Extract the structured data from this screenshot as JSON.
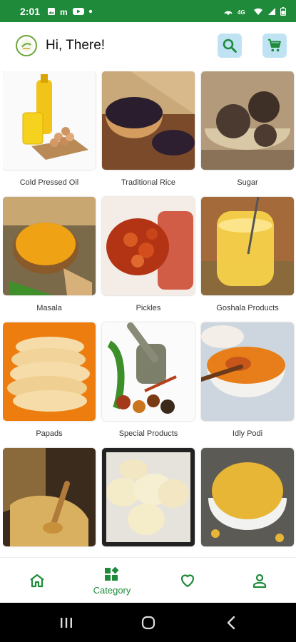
{
  "status_bar": {
    "time": "2:01",
    "icons": [
      "image-icon",
      "m-icon",
      "youtube-icon",
      "dot-icon",
      "hotspot-icon",
      "data-icon",
      "wifi-icon",
      "signal-icon",
      "battery-icon"
    ]
  },
  "header": {
    "greeting": "Hi, There!",
    "search_icon": "search-icon",
    "cart_icon": "cart-icon"
  },
  "categories": [
    {
      "label": "Cold Pressed Oil"
    },
    {
      "label": "Traditional Rice"
    },
    {
      "label": "Sugar"
    },
    {
      "label": "Masala"
    },
    {
      "label": "Pickles"
    },
    {
      "label": "Goshala Products"
    },
    {
      "label": "Papads"
    },
    {
      "label": "Special Products"
    },
    {
      "label": "Idly Podi"
    },
    {
      "label": ""
    },
    {
      "label": ""
    },
    {
      "label": ""
    }
  ],
  "bottom_nav": {
    "items": [
      {
        "icon": "home-icon",
        "label": ""
      },
      {
        "icon": "category-icon",
        "label": "Category"
      },
      {
        "icon": "heart-icon",
        "label": ""
      },
      {
        "icon": "profile-icon",
        "label": ""
      }
    ],
    "active_index": 1
  },
  "colors": {
    "status_bar": "#1e8a3a",
    "accent": "#1e8a3a",
    "header_button_bg": "#bfe3f3"
  }
}
